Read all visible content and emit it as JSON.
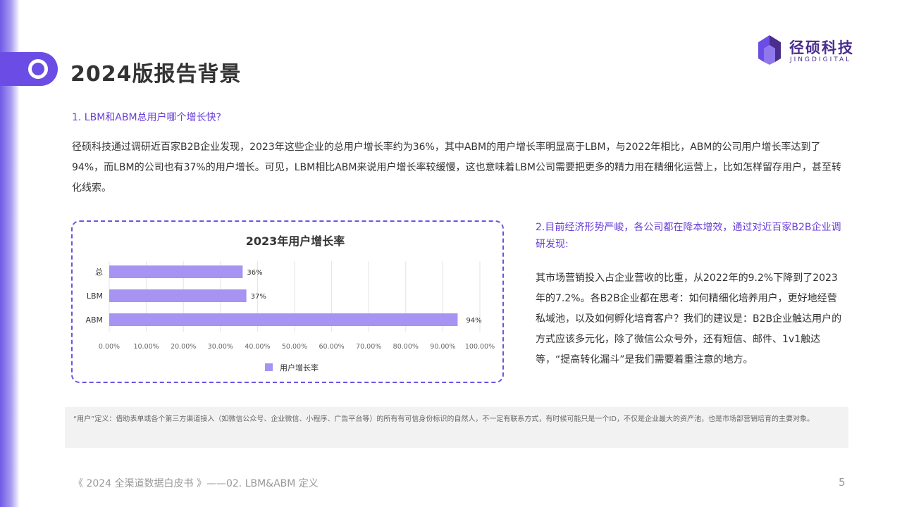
{
  "header": {
    "title": "2024版报告背景",
    "logo_cn": "径硕科技",
    "logo_en": "JINGDIGITAL"
  },
  "section1": {
    "heading": "1. LBM和ABM总用户哪个增长快?",
    "body": "径硕科技通过调研近百家B2B企业发现，2023年这些企业的总用户增长率约为36%，其中ABM的用户增长率明显高于LBM，与2022年相比，ABM的公司用户增长率达到了94%，而LBM的公司也有37%的用户增长。可见，LBM相比ABM来说用户增长率较缓慢，这也意味着LBM公司需要把更多的精力用在精细化运营上，比如怎样留存用户，甚至转化线索。"
  },
  "section2": {
    "heading": "2.目前经济形势严峻，各公司都在降本增效，通过对近百家B2B企业调研发现:",
    "body": "其市场营销投入占企业营收的比重，从2022年的9.2%下降到了2023年的7.2%。各B2B企业都在思考：如何精细化培养用户，更好地经营私域池，以及如何孵化培育客户？我们的建议是：B2B企业触达用户的方式应该多元化，除了微信公众号外，还有短信、邮件、1v1触达等，“提高转化漏斗”是我们需要着重注意的地方。"
  },
  "footnote": "“用户”定义：借助表单或各个第三方渠道接入（如微信公众号、企业微信、小程序、广告平台等）的所有有可信身份标识的自然人，不一定有联系方式，有时候可能只是一个ID，不仅是企业最大的资产池，也是市场部营销培育的主要对象。",
  "footer": {
    "left": "《 2024 全渠道数据白皮书 》——02. LBM&ABM 定义",
    "page": "5"
  },
  "colors": {
    "accent": "#6b4de6",
    "bar": "#a693f2",
    "heading": "#6b3fd6"
  },
  "chart_data": {
    "type": "bar",
    "orientation": "horizontal",
    "title": "2023年用户增长率",
    "categories": [
      "总",
      "LBM",
      "ABM"
    ],
    "series": [
      {
        "name": "用户增长率",
        "values": [
          0.36,
          0.37,
          0.94
        ]
      }
    ],
    "data_labels": [
      "36%",
      "37%",
      "94%"
    ],
    "xlim": [
      0,
      1
    ],
    "x_ticks": [
      0,
      0.1,
      0.2,
      0.3,
      0.4,
      0.5,
      0.6,
      0.7,
      0.8,
      0.9,
      1.0
    ],
    "x_tick_labels": [
      "0.00%",
      "10.00%",
      "20.00%",
      "30.00%",
      "40.00%",
      "50.00%",
      "60.00%",
      "70.00%",
      "80.00%",
      "90.00%",
      "100.00%"
    ],
    "grid": true,
    "legend": "bottom"
  }
}
